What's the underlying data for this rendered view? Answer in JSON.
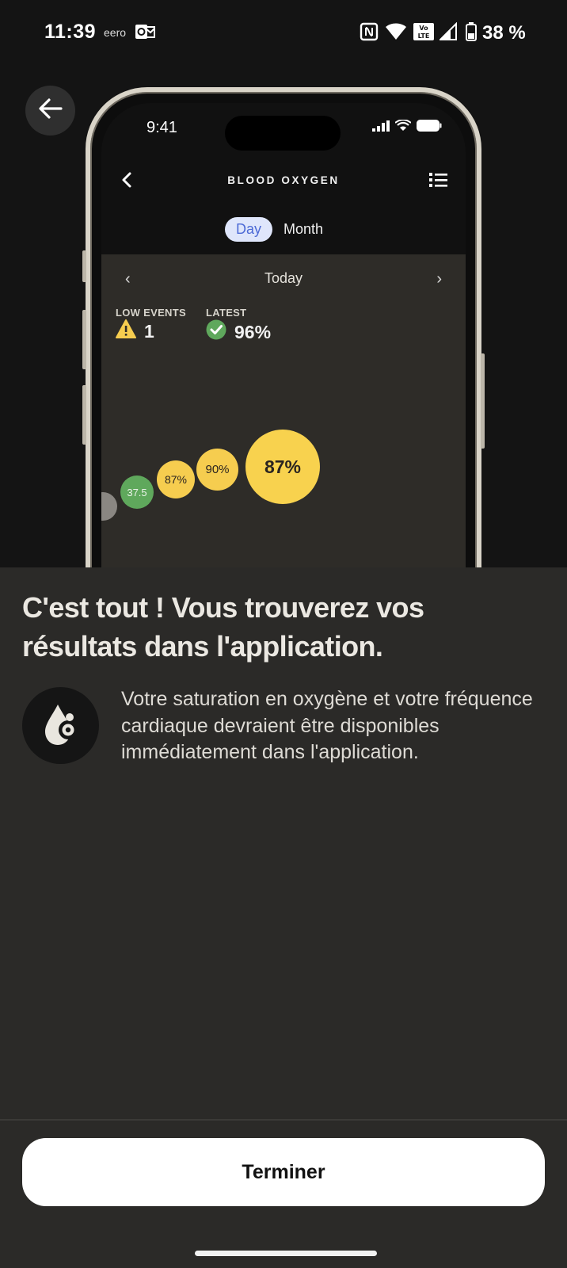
{
  "status_bar": {
    "time": "11:39",
    "network_label": "eero",
    "battery_percent": "38 %",
    "icons": [
      "outlook-icon",
      "nfc-icon",
      "wifi-icon",
      "volte-icon",
      "signal-icon",
      "battery-icon"
    ]
  },
  "back_button": {
    "icon": "arrow-left-icon"
  },
  "phone_mockup": {
    "time": "9:41",
    "title": "BLOOD OXYGEN",
    "tabs": {
      "day": "Day",
      "month": "Month",
      "selected": "Day"
    },
    "date_nav": {
      "label": "Today"
    },
    "stats": {
      "low_events": {
        "label": "LOW EVENTS",
        "value": "1",
        "icon": "warning-icon"
      },
      "latest": {
        "label": "LATEST",
        "value": "96%",
        "icon": "check-circle-icon"
      }
    },
    "bubbles": [
      {
        "label": "",
        "color": "#8a8782"
      },
      {
        "label": "37.5",
        "color": "#5fa85c"
      },
      {
        "label": "87%",
        "color": "#f6cd4f"
      },
      {
        "label": "90%",
        "color": "#f6cd4f"
      },
      {
        "label": "87%",
        "color": "#f8d24e"
      }
    ]
  },
  "content": {
    "headline": "C'est tout ! Vous trouverez vos résultats dans l'application.",
    "info_icon": "blood-drop-icon",
    "info_text": "Votre saturation en oxygène et votre fréquence cardiaque devraient être disponibles immédiatement dans l'application."
  },
  "footer": {
    "button_label": "Terminer"
  },
  "colors": {
    "hero_background": "#141414",
    "page_background": "#2b2a28",
    "accent_yellow": "#f6cd4f",
    "accent_green": "#5fa85c",
    "tab_selected_bg": "#dfe6fb",
    "tab_selected_text": "#4e6bd6"
  }
}
